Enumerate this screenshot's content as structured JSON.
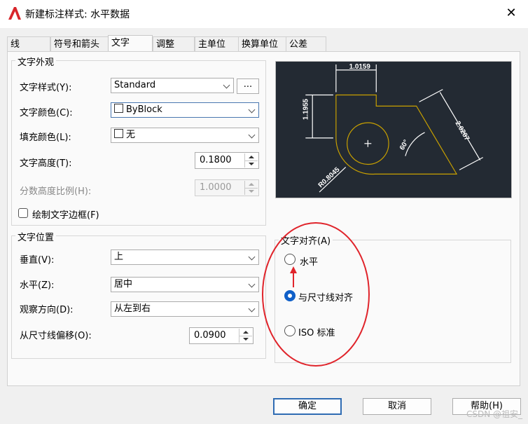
{
  "window": {
    "title": "新建标注样式: 水平数据",
    "close_glyph": "✕"
  },
  "tabs": [
    "线",
    "符号和箭头",
    "文字",
    "调整",
    "主单位",
    "换算单位",
    "公差"
  ],
  "active_tab": "文字",
  "appearance": {
    "title": "文字外观",
    "text_style_label": "文字样式(Y):",
    "text_style_value": "Standard",
    "dots_label": "...",
    "text_color_label": "文字颜色(C):",
    "text_color_value": "ByBlock",
    "fill_color_label": "填充颜色(L):",
    "fill_color_value": "无",
    "text_height_label": "文字高度(T):",
    "text_height_value": "0.1800",
    "fraction_scale_label": "分数高度比例(H):",
    "fraction_scale_value": "1.0000",
    "draw_frame_label": "绘制文字边框(F)",
    "draw_frame_checked": false
  },
  "placement": {
    "title": "文字位置",
    "vertical_label": "垂直(V):",
    "vertical_value": "上",
    "horizontal_label": "水平(Z):",
    "horizontal_value": "居中",
    "view_dir_label": "观察方向(D):",
    "view_dir_value": "从左到右",
    "offset_label": "从尺寸线偏移(O):",
    "offset_value": "0.0900"
  },
  "alignment": {
    "title": "文字对齐(A)",
    "options": [
      "水平",
      "与尺寸线对齐",
      "ISO 标准"
    ],
    "selected": "与尺寸线对齐"
  },
  "preview": {
    "dim_top": "1.0159",
    "dim_left": "1.1955",
    "dim_slant": "2.0207",
    "dim_angle": "60°",
    "dim_radius": "R0.8045"
  },
  "buttons": {
    "ok": "确定",
    "cancel": "取消",
    "help": "帮助(H)"
  },
  "watermark": "CSDN @祖安_",
  "colors": {
    "accent": "#0f5fc8",
    "annotation_red": "#e0242b",
    "preview_bg": "#232a33",
    "preview_line": "#ffffff",
    "preview_shape": "#c8a000"
  }
}
